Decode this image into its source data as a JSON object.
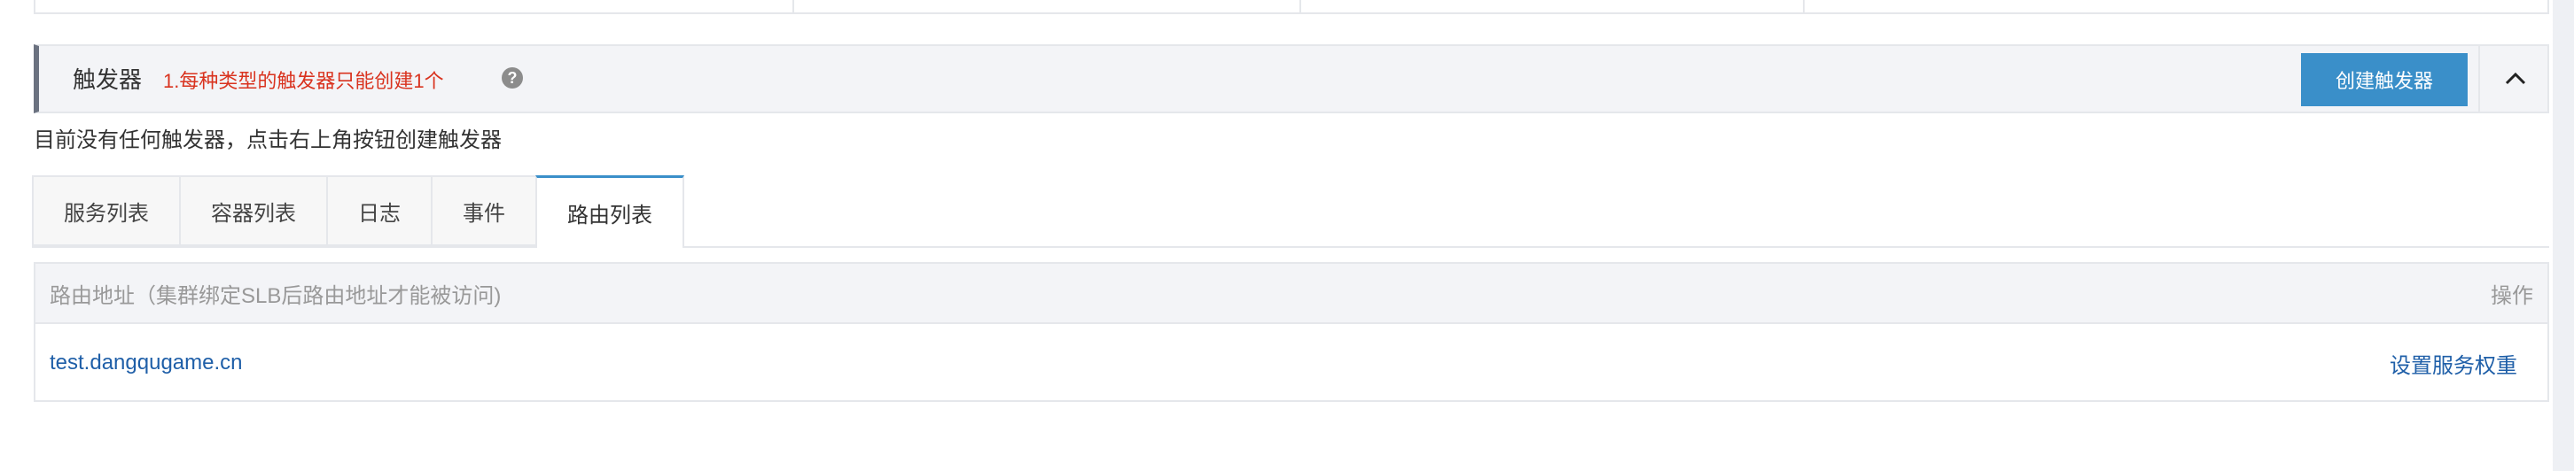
{
  "trigger": {
    "title": "触发器",
    "note": "1.每种类型的触发器只能创建1个",
    "help_icon": "?",
    "create_button": "创建触发器",
    "empty_message": "目前没有任何触发器，点击右上角按钮创建触发器"
  },
  "tabs": [
    {
      "label": "服务列表"
    },
    {
      "label": "容器列表"
    },
    {
      "label": "日志"
    },
    {
      "label": "事件"
    },
    {
      "label": "路由列表"
    }
  ],
  "route_table": {
    "col_address": "路由地址（集群绑定SLB后路由地址才能被访问)",
    "col_action": "操作",
    "rows": [
      {
        "address": "test.dangqugame.cn",
        "action": "设置服务权重"
      }
    ]
  },
  "colors": {
    "accent": "#3a8fc9",
    "note_red": "#d9331f",
    "link": "#1f5fa8"
  }
}
